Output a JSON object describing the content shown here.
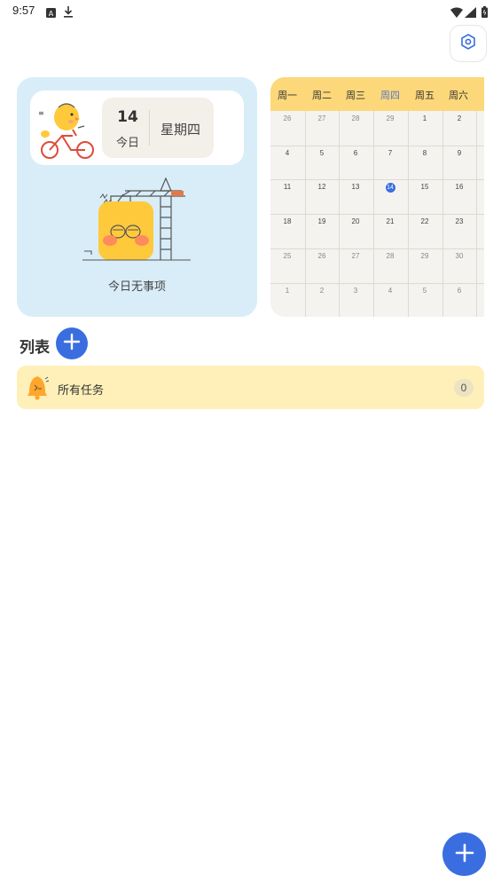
{
  "status_bar": {
    "time": "9:57",
    "icons": [
      "notification-a-icon",
      "download-icon",
      "wifi-icon",
      "signal-icon",
      "battery-icon"
    ]
  },
  "settings": {
    "icon": "settings-hex-icon"
  },
  "today_card": {
    "day_number": "14",
    "today_label": "今日",
    "weekday": "星期四",
    "empty_text": "今日无事项"
  },
  "calendar": {
    "weekdays": [
      "周一",
      "周二",
      "周三",
      "周四",
      "周五",
      "周六"
    ],
    "active_weekday": "周四",
    "weeks": [
      [
        "26",
        "27",
        "28",
        "29",
        "1",
        "2"
      ],
      [
        "4",
        "5",
        "6",
        "7",
        "8",
        "9"
      ],
      [
        "11",
        "12",
        "13",
        "14",
        "15",
        "16"
      ],
      [
        "18",
        "19",
        "20",
        "21",
        "22",
        "23"
      ],
      [
        "25",
        "26",
        "27",
        "28",
        "29",
        "30"
      ],
      [
        "1",
        "2",
        "3",
        "4",
        "5",
        "6"
      ]
    ],
    "today": "14",
    "accent": "#3a6ee0",
    "header_color": "#fdd87a"
  },
  "lists": {
    "title": "列表",
    "items": [
      {
        "label": "所有任务",
        "count": "0",
        "icon": "bell-chick-icon"
      }
    ]
  },
  "fab": {
    "icon": "plus-icon"
  }
}
